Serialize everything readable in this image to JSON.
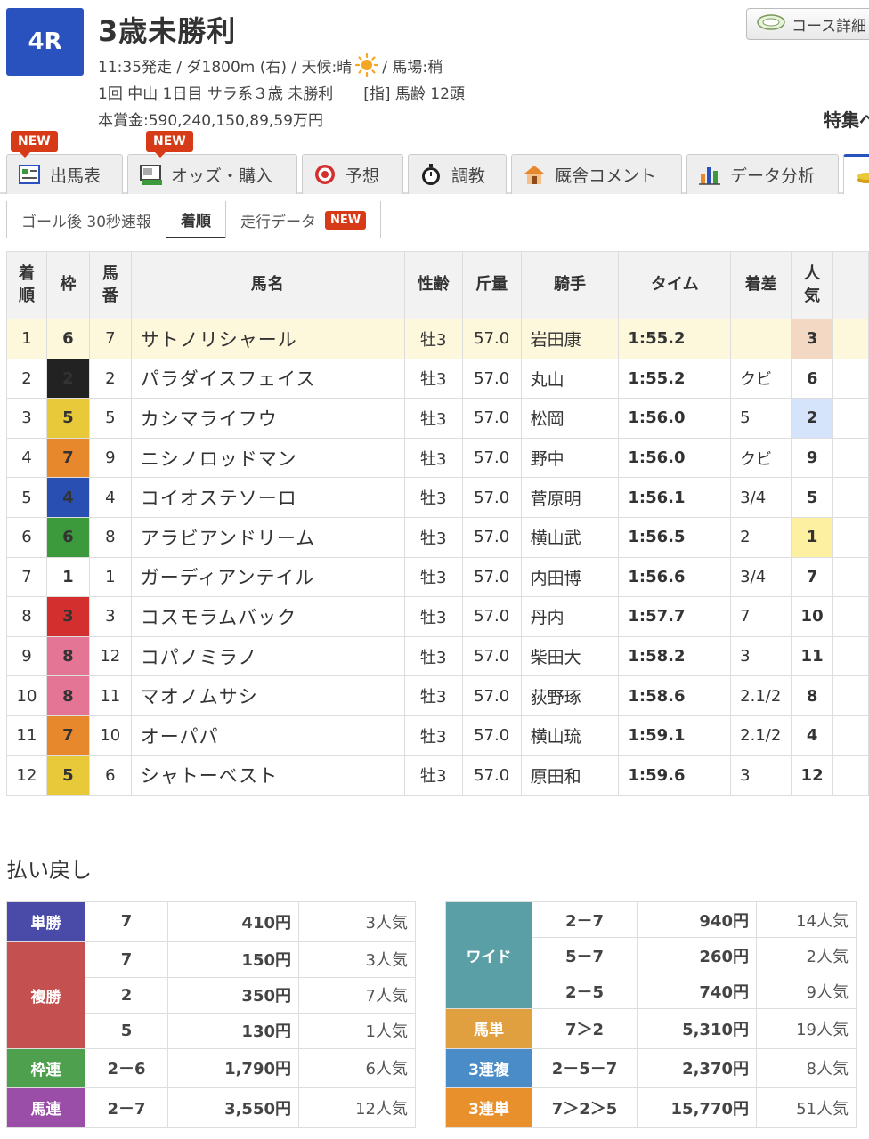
{
  "race": {
    "number": "4R",
    "title": "3歳未勝利",
    "info1_a": "11:35発走 / ダ1800m (右) / 天候:晴",
    "info1_b": "/ 馬場:稍",
    "info2": "1回 中山 1日目 サラ系３歳 未勝利　　[指] 馬齢 12頭",
    "info3": "本賞金:590,240,150,89,59万円",
    "weather_icon": "sun-icon"
  },
  "header": {
    "course_button": "コース詳細",
    "tokushu": "特集ペ"
  },
  "tabs": [
    {
      "label": "出馬表",
      "new": "NEW",
      "icon": "entry-table-icon"
    },
    {
      "label": "オッズ・購入",
      "new": "NEW",
      "icon": "ipat-icon"
    },
    {
      "label": "予想",
      "icon": "target-icon"
    },
    {
      "label": "調教",
      "icon": "stopwatch-icon"
    },
    {
      "label": "厩舎コメント",
      "icon": "stable-icon"
    },
    {
      "label": "データ分析",
      "icon": "bar-chart-icon"
    }
  ],
  "subnav": [
    {
      "label": "ゴール後 30秒速報"
    },
    {
      "label": "着順"
    },
    {
      "label": "走行データ",
      "badge": "NEW"
    }
  ],
  "table": {
    "headers": {
      "rank_a": "着",
      "rank_b": "順",
      "waku": "枠",
      "num_a": "馬",
      "num_b": "番",
      "name": "馬名",
      "sex": "性齢",
      "weight": "斤量",
      "jockey": "騎手",
      "time": "タイム",
      "margin": "着差",
      "pop_a": "人",
      "pop_b": "気"
    },
    "rows": [
      {
        "rank": "1",
        "waku": "6",
        "num": "7",
        "name": "サトノリシャール",
        "sex": "牡3",
        "weight": "57.0",
        "jockey": "岩田康",
        "time": "1:55.2",
        "margin": "",
        "pop": "3"
      },
      {
        "rank": "2",
        "waku": "2",
        "num": "2",
        "name": "パラダイスフェイス",
        "sex": "牡3",
        "weight": "57.0",
        "jockey": "丸山",
        "time": "1:55.2",
        "margin": "クビ",
        "pop": "6"
      },
      {
        "rank": "3",
        "waku": "5",
        "num": "5",
        "name": "カシマライフウ",
        "sex": "牡3",
        "weight": "57.0",
        "jockey": "松岡",
        "time": "1:56.0",
        "margin": "5",
        "pop": "2"
      },
      {
        "rank": "4",
        "waku": "7",
        "num": "9",
        "name": "ニシノロッドマン",
        "sex": "牡3",
        "weight": "57.0",
        "jockey": "野中",
        "time": "1:56.0",
        "margin": "クビ",
        "pop": "9"
      },
      {
        "rank": "5",
        "waku": "4",
        "num": "4",
        "name": "コイオステソーロ",
        "sex": "牡3",
        "weight": "57.0",
        "jockey": "菅原明",
        "time": "1:56.1",
        "margin": "3/4",
        "pop": "5"
      },
      {
        "rank": "6",
        "waku": "6",
        "num": "8",
        "name": "アラビアンドリーム",
        "sex": "牡3",
        "weight": "57.0",
        "jockey": "横山武",
        "time": "1:56.5",
        "margin": "2",
        "pop": "1"
      },
      {
        "rank": "7",
        "waku": "1",
        "num": "1",
        "name": "ガーディアンテイル",
        "sex": "牡3",
        "weight": "57.0",
        "jockey": "内田博",
        "time": "1:56.6",
        "margin": "3/4",
        "pop": "7"
      },
      {
        "rank": "8",
        "waku": "3",
        "num": "3",
        "name": "コスモラムバック",
        "sex": "牡3",
        "weight": "57.0",
        "jockey": "丹内",
        "time": "1:57.7",
        "margin": "7",
        "pop": "10"
      },
      {
        "rank": "9",
        "waku": "8",
        "num": "12",
        "name": "コパノミラノ",
        "sex": "牡3",
        "weight": "57.0",
        "jockey": "柴田大",
        "time": "1:58.2",
        "margin": "3",
        "pop": "11"
      },
      {
        "rank": "10",
        "waku": "8",
        "num": "11",
        "name": "マオノムサシ",
        "sex": "牡3",
        "weight": "57.0",
        "jockey": "荻野琢",
        "time": "1:58.6",
        "margin": "2.1/2",
        "pop": "8"
      },
      {
        "rank": "11",
        "waku": "7",
        "num": "10",
        "name": "オーパパ",
        "sex": "牡3",
        "weight": "57.0",
        "jockey": "横山琉",
        "time": "1:59.1",
        "margin": "2.1/2",
        "pop": "4"
      },
      {
        "rank": "12",
        "waku": "5",
        "num": "6",
        "name": "シャトーベスト",
        "sex": "牡3",
        "weight": "57.0",
        "jockey": "原田和",
        "time": "1:59.6",
        "margin": "3",
        "pop": "12"
      }
    ]
  },
  "payout": {
    "title": "払い戻し",
    "left": [
      {
        "type": "単勝",
        "color": "#4a4aa8",
        "entries": [
          {
            "combo": "7",
            "amount": "410円",
            "pop": "3人気"
          }
        ]
      },
      {
        "type": "複勝",
        "color": "#c55050",
        "entries": [
          {
            "combo": "7",
            "amount": "150円",
            "pop": "3人気"
          },
          {
            "combo": "2",
            "amount": "350円",
            "pop": "7人気"
          },
          {
            "combo": "5",
            "amount": "130円",
            "pop": "1人気"
          }
        ]
      },
      {
        "type": "枠連",
        "color": "#4ea04e",
        "entries": [
          {
            "combo": "2－6",
            "amount": "1,790円",
            "pop": "6人気"
          }
        ]
      },
      {
        "type": "馬連",
        "color": "#9a4ea8",
        "entries": [
          {
            "combo": "2－7",
            "amount": "3,550円",
            "pop": "12人気"
          }
        ]
      }
    ],
    "right": [
      {
        "type": "ワイド",
        "color": "#5a9fa5",
        "entries": [
          {
            "combo": "2－7",
            "amount": "940円",
            "pop": "14人気"
          },
          {
            "combo": "5－7",
            "amount": "260円",
            "pop": "2人気"
          },
          {
            "combo": "2－5",
            "amount": "740円",
            "pop": "9人気"
          }
        ]
      },
      {
        "type": "馬単",
        "color": "#e0a040",
        "entries": [
          {
            "combo": "7＞2",
            "amount": "5,310円",
            "pop": "19人気"
          }
        ]
      },
      {
        "type": "3連複",
        "color": "#4a8cc8",
        "entries": [
          {
            "combo": "2－5－7",
            "amount": "2,370円",
            "pop": "8人気"
          }
        ]
      },
      {
        "type": "3連単",
        "color": "#e8902c",
        "entries": [
          {
            "combo": "7＞2＞5",
            "amount": "15,770円",
            "pop": "51人気"
          }
        ]
      }
    ]
  }
}
